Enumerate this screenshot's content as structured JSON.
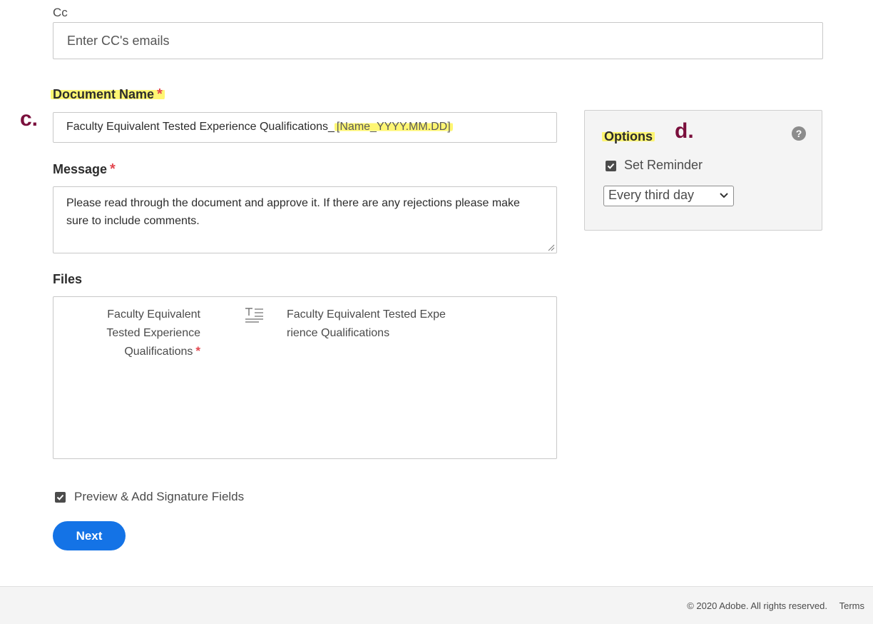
{
  "cc": {
    "label": "Cc",
    "placeholder": "Enter CC's emails",
    "value": ""
  },
  "document_name": {
    "label": "Document Name",
    "required_mark": "*",
    "value_prefix": "Faculty Equivalent Tested Experience Qualifications_",
    "value_suffix": "[Name_YYYY.MM.DD]"
  },
  "annotations": {
    "marker_c": "c.",
    "marker_d": "d."
  },
  "message": {
    "label": "Message",
    "required_mark": "*",
    "value": "Please read through the document and approve it. If there are any rejections please make sure to include comments."
  },
  "files": {
    "label": "Files",
    "items": [
      {
        "name_lines": [
          "Faculty Equivalent",
          "Tested Experience",
          "Qualifications"
        ],
        "required_mark": "*",
        "type_icon": "text-field-icon",
        "file_lines": [
          "Faculty Equivalent Tested Expe",
          "rience Qualifications"
        ]
      }
    ]
  },
  "options": {
    "title": "Options",
    "help_icon": "question-circle-icon",
    "help_glyph": "?",
    "set_reminder": {
      "label": "Set Reminder",
      "checked": true
    },
    "reminder_frequency": {
      "selected": "Every third day"
    }
  },
  "preview": {
    "label": "Preview & Add Signature Fields",
    "checked": true
  },
  "next_button": {
    "label": "Next",
    "color": "#1473e6"
  },
  "footer": {
    "copyright": "© 2020 Adobe. All rights reserved.",
    "terms": "Terms"
  },
  "colors": {
    "highlight": "#fff55a",
    "marker": "#7a0f3c",
    "required": "#e34850"
  }
}
